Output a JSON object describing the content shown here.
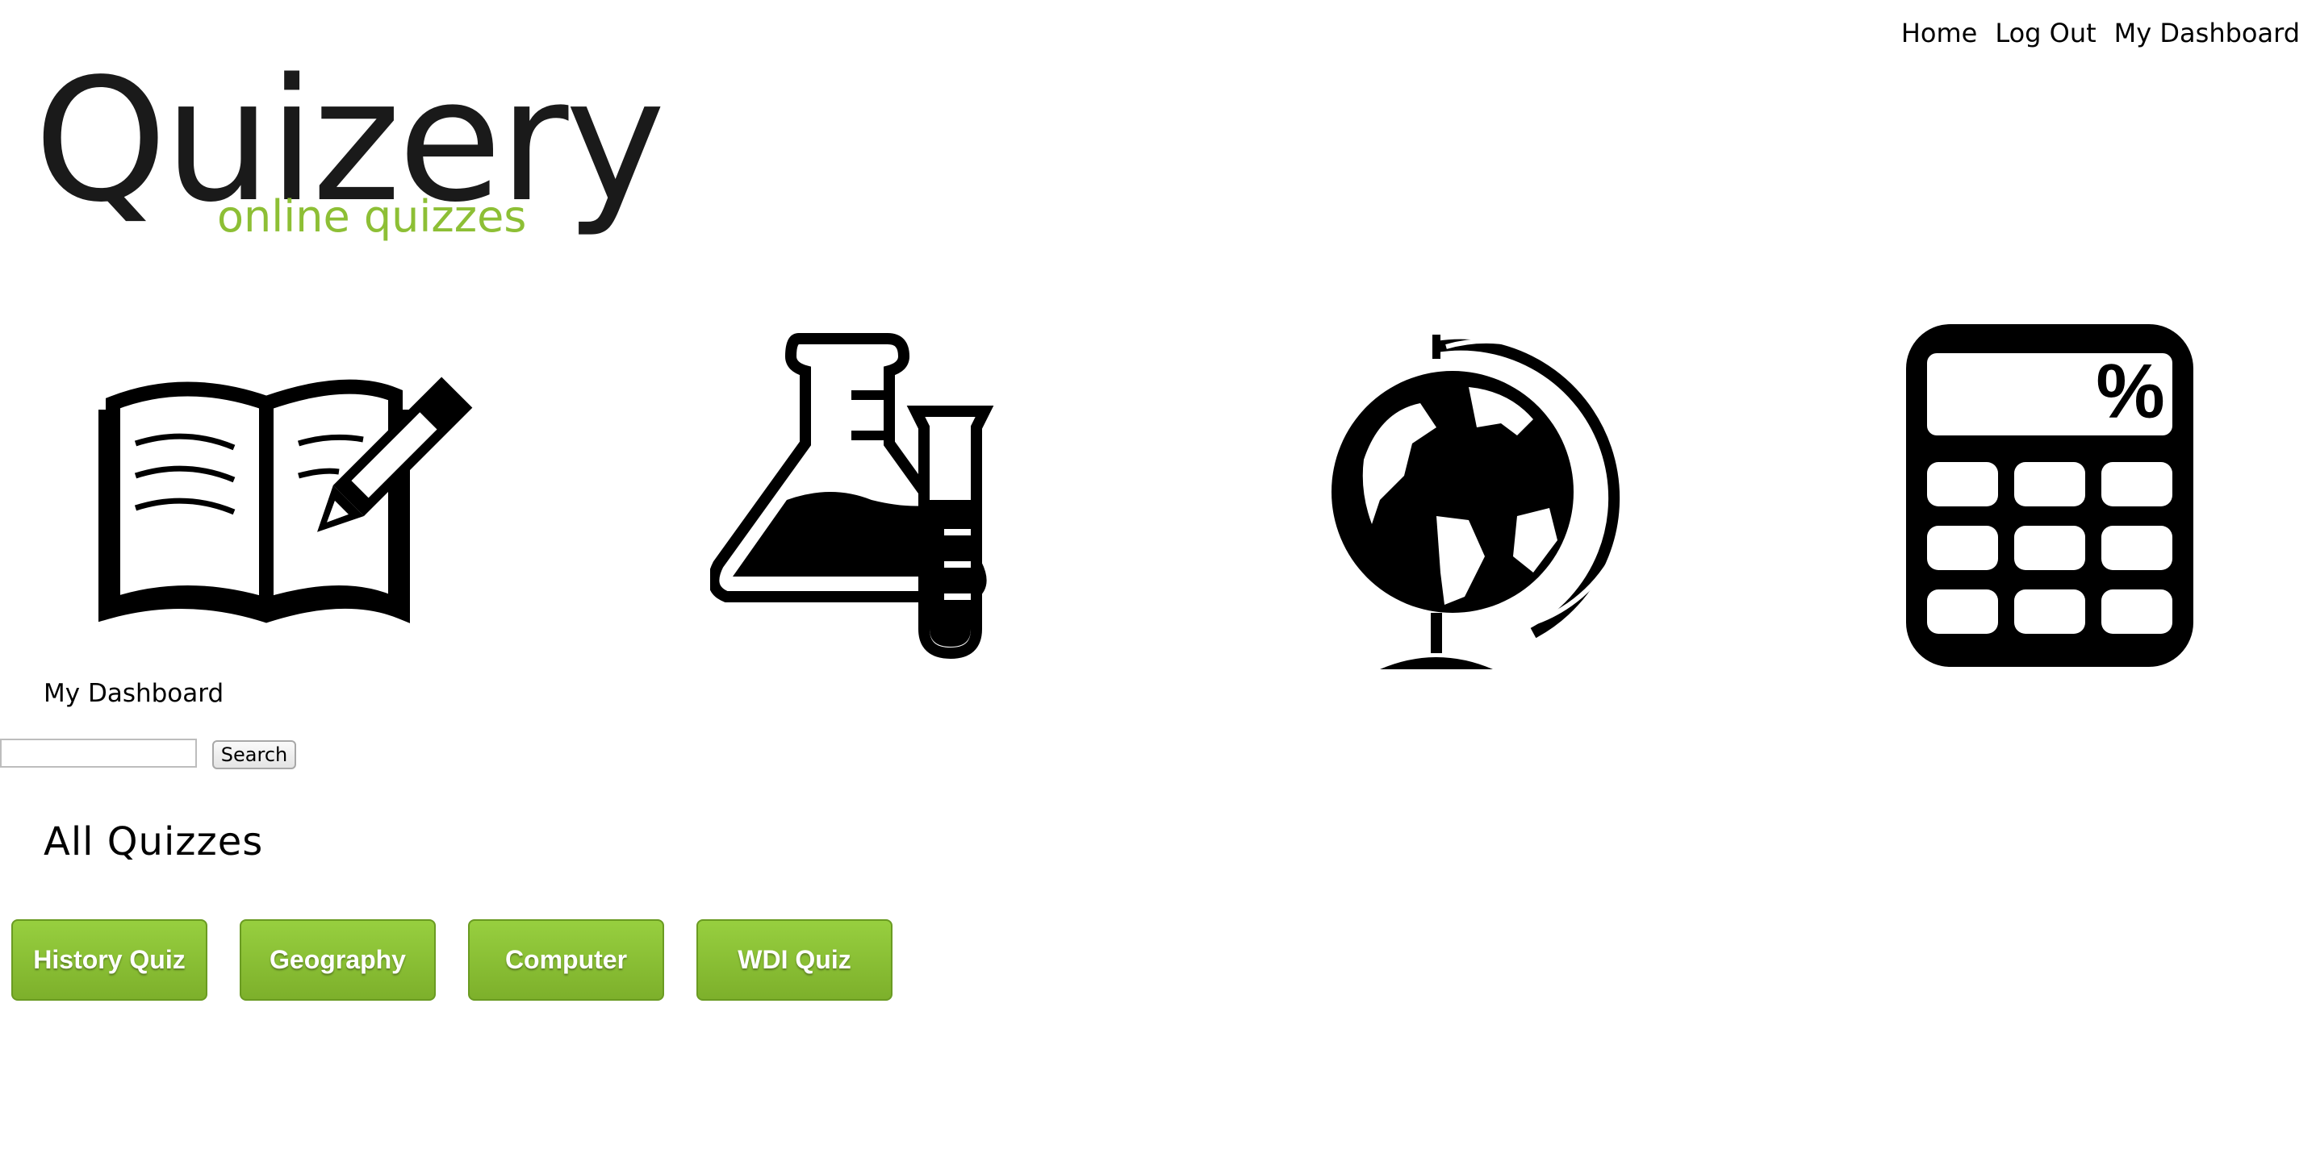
{
  "nav": {
    "home": "Home",
    "logout": "Log Out",
    "dashboard": "My Dashboard"
  },
  "logo": {
    "title": "Quizery",
    "subtitle": "online quizzes",
    "accent_color": "#8dbf35"
  },
  "categories": [
    {
      "icon": "book-pencil-icon"
    },
    {
      "icon": "science-flask-icon"
    },
    {
      "icon": "globe-icon"
    },
    {
      "icon": "calculator-icon"
    }
  ],
  "dashboard_link": "My Dashboard",
  "search": {
    "value": "",
    "placeholder": "",
    "button_label": "Search"
  },
  "section_title": "All Quizzes",
  "quizzes": [
    {
      "label": "History Quiz"
    },
    {
      "label": "Geography"
    },
    {
      "label": "Computer"
    },
    {
      "label": "WDI Quiz"
    }
  ],
  "colors": {
    "button_green": "#8dc63f"
  }
}
